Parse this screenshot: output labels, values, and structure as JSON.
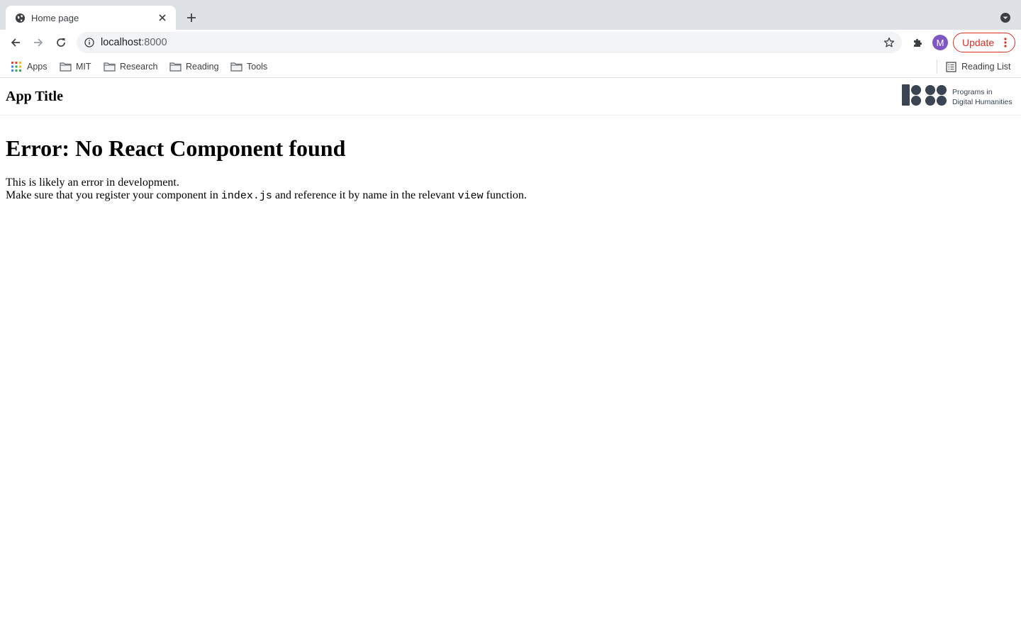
{
  "browser": {
    "tab": {
      "title": "Home page"
    },
    "address": {
      "host": "localhost",
      "port": ":8000"
    },
    "profile_initial": "M",
    "update_label": "Update",
    "bookmarks": [
      {
        "label": "Apps",
        "icon": "apps-grid-icon"
      },
      {
        "label": "MIT",
        "icon": "folder-icon"
      },
      {
        "label": "Research",
        "icon": "folder-icon"
      },
      {
        "label": "Reading",
        "icon": "folder-icon"
      },
      {
        "label": "Tools",
        "icon": "folder-icon"
      }
    ],
    "reading_list": {
      "label": "Reading List",
      "icon": "reading-list-icon"
    }
  },
  "app": {
    "title": "App Title",
    "logo": {
      "line1": "Programs in",
      "line2": "Digital Humanities"
    }
  },
  "error": {
    "heading": "Error: No React Component found",
    "line1": "This is likely an error in development.",
    "line2_before": "Make sure that you register your component in",
    "line2_code1": "index.js",
    "line2_middle": "and reference it by name in the relevant",
    "line2_code2": "view",
    "line2_after": "function."
  },
  "colors": {
    "tabstrip": "#dee1e6",
    "update_red": "#d93025",
    "avatar_purple": "#7e57c2",
    "logo_slate": "#3a4452"
  }
}
